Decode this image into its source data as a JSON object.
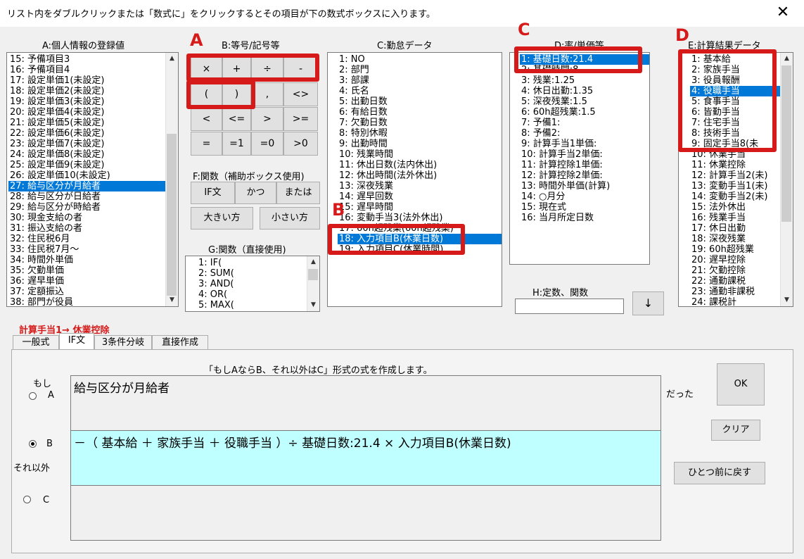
{
  "window": {
    "title": "リスト内をダブルクリックまたは「数式に」をクリックするとその項目が下の数式ボックスに入ります。"
  },
  "labels": {
    "a": "A:個人情報の登録値",
    "b": "B:等号/記号等",
    "c": "C:勤怠データ",
    "d": "D:率/単価等",
    "e": "E:計算結果データ",
    "f": "F:関数（補助ボックス使用)",
    "g": "G:関数（直接使用)",
    "h": "H:定数、関数"
  },
  "annotations": {
    "a": "A",
    "b": "B",
    "c": "C",
    "d": "D"
  },
  "list_a": [
    "15: 予備項目3",
    "16: 予備項目4",
    "17: 設定単価1(未設定)",
    "18: 設定単価2(未設定)",
    "19: 設定単価3(未設定)",
    "20: 設定単価4(未設定)",
    "21: 設定単価5(未設定)",
    "22: 設定単価6(未設定)",
    "23: 設定単価7(未設定)",
    "24: 設定単価8(未設定)",
    "25: 設定単価9(未設定)",
    "26: 設定単価10(未設定)",
    "27: 給与区分が月給者",
    "28: 給与区分が日給者",
    "29: 給与区分が時給者",
    "30: 現金支給の者",
    "31: 振込支給の者",
    "32: 住民税6月",
    "33: 住民税7月～",
    "34: 時間外単価",
    "35: 欠勤単価",
    "36: 遅早単価",
    "37: 定額振込",
    "38: 部門が役員"
  ],
  "list_c": [
    "1: NO",
    "2: 部門",
    "3: 部課",
    "4: 氏名",
    "5: 出勤日数",
    "6: 有給日数",
    "7: 欠勤日数",
    "8: 特別休暇",
    "9: 出勤時間",
    "10: 残業時間",
    "11: 休出日数(法内休出)",
    "12: 休出時間(法外休出)",
    "13: 深夜残業",
    "14: 遅早回数",
    "15: 遅早時間",
    "16: 変動手当3(法外休出)",
    "17: 60h超残業(60h超残業)",
    "18: 入力項目B(休業日数)",
    "19: 入力項目C(休業時間)"
  ],
  "list_d": [
    "1: 基礎日数:21.4",
    "2: 基礎時間:8",
    "3: 残業:1.25",
    "4: 休日出勤:1.35",
    "5: 深夜残業:1.5",
    "6: 60h超残業:1.5",
    "7: 予備1:",
    "8: 予備2:",
    "9: 計算手当1単価:",
    "10: 計算手当2単価:",
    "11: 計算控除1単価:",
    "12: 計算控除2単価:",
    "13: 時間外単価(計算)",
    "14: ○月分",
    "15: 現在式",
    "16: 当月所定日数"
  ],
  "list_e": [
    "1: 基本給",
    "2: 家族手当",
    "3: 役員報酬",
    "4: 役職手当",
    "5: 食事手当",
    "6: 皆勤手当",
    "7: 住宅手当",
    "8: 技術手当",
    "9: 固定手当8(未",
    "10: 休業手当",
    "11: 休業控除",
    "12: 計算手当2(未)",
    "13: 変動手当1(未)",
    "14: 変動手当2(未)",
    "15: 法外休出",
    "16: 残業手当",
    "17: 休日出勤",
    "18: 深夜残業",
    "19: 60h超残業",
    "20: 遅早控除",
    "21: 欠勤控除",
    "22: 通勤課税",
    "23: 通勤非課税",
    "24: 課税計"
  ],
  "list_g": [
    "1: IF(",
    "2: SUM(",
    "3: AND(",
    "4: OR(",
    "5: MAX("
  ],
  "ops": [
    [
      "×",
      "+",
      "÷",
      "-"
    ],
    [
      "(",
      ")",
      ",",
      "<>"
    ],
    [
      "<",
      "<=",
      ">",
      ">="
    ],
    [
      "=",
      "=1",
      "=0",
      ">0"
    ]
  ],
  "func_buttons": {
    "if": "IF文",
    "and": "かつ",
    "or": "または",
    "max": "大きい方",
    "min": "小さい方"
  },
  "h_input": {
    "value": ""
  },
  "arrow_button": "↓",
  "formula_target": "計算手当1→  休業控除",
  "tabs": [
    "一般式",
    "IF文",
    "3条件分岐",
    "直接作成"
  ],
  "if_panel": {
    "description": "「もしAならB、それ以外はC」形式の式を作成します。",
    "moshi": "もし",
    "datta": "だった",
    "sore_igai": "それ以外",
    "radio_a": "A",
    "radio_b": "B",
    "radio_c": "C",
    "expr_a": "給与区分が月給者",
    "expr_b": "－（ 基本給 ＋ 家族手当 ＋ 役職手当 ）÷ 基礎日数:21.4 × 入力項目B(休業日数)",
    "expr_c": "",
    "ok": "OK",
    "clear": "クリア",
    "undo": "ひとつ前に戻す"
  }
}
